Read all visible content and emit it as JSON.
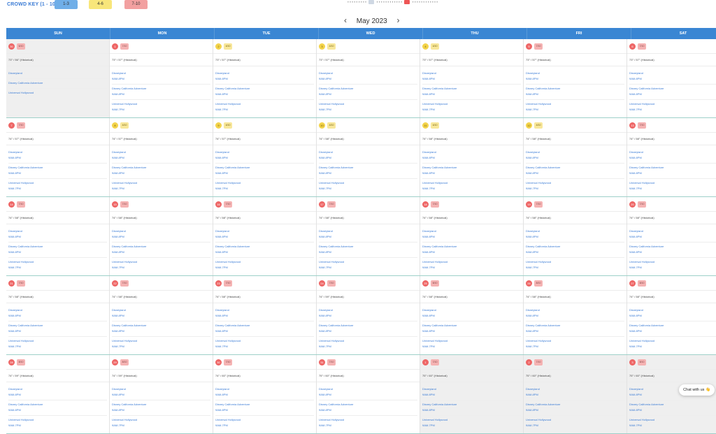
{
  "crowd_key": {
    "label": "CROWD KEY (1 - 10):",
    "levels": [
      {
        "range": "1-3",
        "color": "#6faee8"
      },
      {
        "range": "4-6",
        "color": "#f8e67a"
      },
      {
        "range": "7-10",
        "color": "#f2a0a0"
      }
    ]
  },
  "legend": {
    "text_a": "• • • • • • • • •",
    "text_b": "• • • • • • • • • • • •",
    "text_c": "• • • • • • • • • • • •"
  },
  "month_nav": {
    "title": "May 2023",
    "prev": "‹",
    "next": "›"
  },
  "weekdays": [
    "SUN",
    "MON",
    "TUE",
    "WED",
    "THU",
    "FRI",
    "SAT"
  ],
  "weeks": [
    {
      "days": [
        {
          "num": "30",
          "badge": "6/10",
          "color": "red",
          "weather": "73° / 56° (Historical)",
          "other": true,
          "parks": [
            {
              "name": "Disneyland",
              "hours": ""
            },
            {
              "name": "Disney California Adventure",
              "hours": ""
            },
            {
              "name": "Universal Hollywood",
              "hours": ""
            }
          ]
        },
        {
          "num": "1",
          "badge": "7/10",
          "color": "red",
          "weather": "73° / 57° (Historical)",
          "parks": [
            {
              "name": "Disneyland",
              "hours": "9AM-8PM"
            },
            {
              "name": "Disney California Adventure",
              "hours": "9AM-8PM"
            },
            {
              "name": "Universal Hollywood",
              "hours": "9AM-7PM"
            }
          ]
        },
        {
          "num": "2",
          "badge": "4/10",
          "color": "yellow",
          "weather": "73° / 57° (Historical)",
          "parks": [
            {
              "name": "Disneyland",
              "hours": "9AM-8PM"
            },
            {
              "name": "Disney California Adventure",
              "hours": "9AM-8PM"
            },
            {
              "name": "Universal Hollywood",
              "hours": "9AM-7PM"
            }
          ]
        },
        {
          "num": "3",
          "badge": "4/10",
          "color": "yellow",
          "weather": "73° / 57° (Historical)",
          "parks": [
            {
              "name": "Disneyland",
              "hours": "9AM-8PM"
            },
            {
              "name": "Disney California Adventure",
              "hours": "9AM-8PM"
            },
            {
              "name": "Universal Hollywood",
              "hours": "9AM-7PM"
            }
          ]
        },
        {
          "num": "4",
          "badge": "4/10",
          "color": "yellow",
          "weather": "73° / 57° (Historical)",
          "parks": [
            {
              "name": "Disneyland",
              "hours": "9AM-8PM"
            },
            {
              "name": "Disney California Adventure",
              "hours": "9AM-8PM"
            },
            {
              "name": "Universal Hollywood",
              "hours": "9AM-7PM"
            }
          ]
        },
        {
          "num": "5",
          "badge": "7/10",
          "color": "red",
          "weather": "73° / 57° (Historical)",
          "parks": [
            {
              "name": "Disneyland",
              "hours": "9AM-8PM"
            },
            {
              "name": "Disney California Adventure",
              "hours": "9AM-8PM"
            },
            {
              "name": "Universal Hollywood",
              "hours": "9AM-7PM"
            }
          ]
        },
        {
          "num": "6",
          "badge": "7/10",
          "color": "red",
          "weather": "73° / 57° (Historical)",
          "parks": [
            {
              "name": "Disneyland",
              "hours": "9AM-8PM"
            },
            {
              "name": "Disney California Adventure",
              "hours": "9AM-8PM"
            },
            {
              "name": "Universal Hollywood",
              "hours": "9AM-7PM"
            }
          ]
        }
      ]
    },
    {
      "days": [
        {
          "num": "7",
          "badge": "7/10",
          "color": "red",
          "weather": "74° / 57° (Historical)",
          "parks": [
            {
              "name": "Disneyland",
              "hours": "9AM-8PM"
            },
            {
              "name": "Disney California Adventure",
              "hours": "9AM-8PM"
            },
            {
              "name": "Universal Hollywood",
              "hours": "9AM-7PM"
            }
          ]
        },
        {
          "num": "8",
          "badge": "4/10",
          "color": "yellow",
          "weather": "74° / 57° (Historical)",
          "parks": [
            {
              "name": "Disneyland",
              "hours": "9AM-8PM"
            },
            {
              "name": "Disney California Adventure",
              "hours": "9AM-8PM"
            },
            {
              "name": "Universal Hollywood",
              "hours": "9AM-7PM"
            }
          ]
        },
        {
          "num": "9",
          "badge": "4/10",
          "color": "yellow",
          "weather": "74° / 57° (Historical)",
          "parks": [
            {
              "name": "Disneyland",
              "hours": "9AM-8PM"
            },
            {
              "name": "Disney California Adventure",
              "hours": "9AM-8PM"
            },
            {
              "name": "Universal Hollywood",
              "hours": "9AM-7PM"
            }
          ]
        },
        {
          "num": "10",
          "badge": "4/10",
          "color": "yellow",
          "weather": "74° / 58° (Historical)",
          "parks": [
            {
              "name": "Disneyland",
              "hours": "9AM-8PM"
            },
            {
              "name": "Disney California Adventure",
              "hours": "9AM-8PM"
            },
            {
              "name": "Universal Hollywood",
              "hours": "9AM-7PM"
            }
          ]
        },
        {
          "num": "11",
          "badge": "4/10",
          "color": "yellow",
          "weather": "74° / 58° (Historical)",
          "parks": [
            {
              "name": "Disneyland",
              "hours": "9AM-8PM"
            },
            {
              "name": "Disney California Adventure",
              "hours": "9AM-8PM"
            },
            {
              "name": "Universal Hollywood",
              "hours": "9AM-7PM"
            }
          ]
        },
        {
          "num": "12",
          "badge": "4/10",
          "color": "yellow",
          "weather": "74° / 58° (Historical)",
          "parks": [
            {
              "name": "Disneyland",
              "hours": "9AM-8PM"
            },
            {
              "name": "Disney California Adventure",
              "hours": "9AM-8PM"
            },
            {
              "name": "Universal Hollywood",
              "hours": "9AM-7PM"
            }
          ]
        },
        {
          "num": "13",
          "badge": "7/10",
          "color": "red",
          "weather": "74° / 58° (Historical)",
          "parks": [
            {
              "name": "Disneyland",
              "hours": "9AM-8PM"
            },
            {
              "name": "Disney California Adventure",
              "hours": "9AM-8PM"
            },
            {
              "name": "Universal Hollywood",
              "hours": "9AM-7PM"
            }
          ]
        }
      ]
    },
    {
      "days": [
        {
          "num": "14",
          "badge": "7/10",
          "color": "red",
          "weather": "74° / 58° (Historical)",
          "parks": [
            {
              "name": "Disneyland",
              "hours": "9AM-8PM"
            },
            {
              "name": "Disney California Adventure",
              "hours": "9AM-8PM"
            },
            {
              "name": "Universal Hollywood",
              "hours": "9AM-7PM"
            }
          ]
        },
        {
          "num": "15",
          "badge": "7/10",
          "color": "red",
          "weather": "74° / 58° (Historical)",
          "parks": [
            {
              "name": "Disneyland",
              "hours": "9AM-8PM"
            },
            {
              "name": "Disney California Adventure",
              "hours": "9AM-8PM"
            },
            {
              "name": "Universal Hollywood",
              "hours": "9AM-7PM"
            }
          ]
        },
        {
          "num": "16",
          "badge": "7/10",
          "color": "red",
          "weather": "74° / 58° (Historical)",
          "parks": [
            {
              "name": "Disneyland",
              "hours": "9AM-8PM"
            },
            {
              "name": "Disney California Adventure",
              "hours": "9AM-8PM"
            },
            {
              "name": "Universal Hollywood",
              "hours": "9AM-7PM"
            }
          ]
        },
        {
          "num": "17",
          "badge": "7/10",
          "color": "red",
          "weather": "74° / 58° (Historical)",
          "parks": [
            {
              "name": "Disneyland",
              "hours": "9AM-8PM"
            },
            {
              "name": "Disney California Adventure",
              "hours": "9AM-8PM"
            },
            {
              "name": "Universal Hollywood",
              "hours": "9AM-7PM"
            }
          ]
        },
        {
          "num": "18",
          "badge": "7/10",
          "color": "red",
          "weather": "74° / 58° (Historical)",
          "parks": [
            {
              "name": "Disneyland",
              "hours": "9AM-8PM"
            },
            {
              "name": "Disney California Adventure",
              "hours": "9AM-8PM"
            },
            {
              "name": "Universal Hollywood",
              "hours": "9AM-7PM"
            }
          ]
        },
        {
          "num": "19",
          "badge": "7/10",
          "color": "red",
          "weather": "74° / 58° (Historical)",
          "parks": [
            {
              "name": "Disneyland",
              "hours": "9AM-8PM"
            },
            {
              "name": "Disney California Adventure",
              "hours": "9AM-8PM"
            },
            {
              "name": "Universal Hollywood",
              "hours": "9AM-7PM"
            }
          ]
        },
        {
          "num": "20",
          "badge": "7/10",
          "color": "red",
          "weather": "74° / 58° (Historical)",
          "parks": [
            {
              "name": "Disneyland",
              "hours": "9AM-8PM"
            },
            {
              "name": "Disney California Adventure",
              "hours": "9AM-8PM"
            },
            {
              "name": "Universal Hollywood",
              "hours": "9AM-7PM"
            }
          ]
        }
      ]
    },
    {
      "days": [
        {
          "num": "21",
          "badge": "7/10",
          "color": "red",
          "weather": "74° / 58° (Historical)",
          "parks": [
            {
              "name": "Disneyland",
              "hours": "9AM-8PM"
            },
            {
              "name": "Disney California Adventure",
              "hours": "9AM-8PM"
            },
            {
              "name": "Universal Hollywood",
              "hours": "9AM-7PM"
            }
          ]
        },
        {
          "num": "22",
          "badge": "7/10",
          "color": "red",
          "weather": "74° / 58° (Historical)",
          "parks": [
            {
              "name": "Disneyland",
              "hours": "9AM-8PM"
            },
            {
              "name": "Disney California Adventure",
              "hours": "9AM-8PM"
            },
            {
              "name": "Universal Hollywood",
              "hours": "9AM-7PM"
            }
          ]
        },
        {
          "num": "23",
          "badge": "7/10",
          "color": "red",
          "weather": "74° / 58° (Historical)",
          "parks": [
            {
              "name": "Disneyland",
              "hours": "9AM-8PM"
            },
            {
              "name": "Disney California Adventure",
              "hours": "9AM-8PM"
            },
            {
              "name": "Universal Hollywood",
              "hours": "9AM-7PM"
            }
          ]
        },
        {
          "num": "24",
          "badge": "7/10",
          "color": "red",
          "weather": "74° / 59° (Historical)",
          "parks": [
            {
              "name": "Disneyland",
              "hours": "9AM-8PM"
            },
            {
              "name": "Disney California Adventure",
              "hours": "9AM-8PM"
            },
            {
              "name": "Universal Hollywood",
              "hours": "9AM-7PM"
            }
          ]
        },
        {
          "num": "25",
          "badge": "8/10",
          "color": "red",
          "weather": "74° / 58° (Historical)",
          "parks": [
            {
              "name": "Disneyland",
              "hours": "9AM-8PM"
            },
            {
              "name": "Disney California Adventure",
              "hours": "9AM-8PM"
            },
            {
              "name": "Universal Hollywood",
              "hours": "9AM-7PM"
            }
          ]
        },
        {
          "num": "26",
          "badge": "8/10",
          "color": "red",
          "weather": "74° / 58° (Historical)",
          "parks": [
            {
              "name": "Disneyland",
              "hours": "9AM-8PM"
            },
            {
              "name": "Disney California Adventure",
              "hours": "9AM-8PM"
            },
            {
              "name": "Universal Hollywood",
              "hours": "9AM-7PM"
            }
          ]
        },
        {
          "num": "27",
          "badge": "8/10",
          "color": "red",
          "weather": "74° / 58° (Historical)",
          "parks": [
            {
              "name": "Disneyland",
              "hours": "9AM-8PM"
            },
            {
              "name": "Disney California Adventure",
              "hours": "9AM-8PM"
            },
            {
              "name": "Universal Hollywood",
              "hours": "9AM-7PM"
            }
          ]
        }
      ]
    },
    {
      "days": [
        {
          "num": "28",
          "badge": "8/10",
          "color": "red",
          "weather": "74° / 59° (Historical)",
          "parks": [
            {
              "name": "Disneyland",
              "hours": "9AM-8PM"
            },
            {
              "name": "Disney California Adventure",
              "hours": "9AM-8PM"
            },
            {
              "name": "Universal Hollywood",
              "hours": "9AM-7PM"
            }
          ]
        },
        {
          "num": "29",
          "badge": "8/10",
          "color": "red",
          "weather": "74° / 59° (Historical)",
          "parks": [
            {
              "name": "Disneyland",
              "hours": "9AM-8PM"
            },
            {
              "name": "Disney California Adventure",
              "hours": "9AM-8PM"
            },
            {
              "name": "Universal Hollywood",
              "hours": "9AM-7PM"
            }
          ]
        },
        {
          "num": "30",
          "badge": "7/10",
          "color": "red",
          "weather": "74° / 60° (Historical)",
          "parks": [
            {
              "name": "Disneyland",
              "hours": "9AM-8PM"
            },
            {
              "name": "Disney California Adventure",
              "hours": "9AM-8PM"
            },
            {
              "name": "Universal Hollywood",
              "hours": "9AM-7PM"
            }
          ]
        },
        {
          "num": "31",
          "badge": "7/10",
          "color": "red",
          "weather": "75° / 60° (Historical)",
          "parks": [
            {
              "name": "Disneyland",
              "hours": "9AM-8PM"
            },
            {
              "name": "Disney California Adventure",
              "hours": "9AM-8PM"
            },
            {
              "name": "Universal Hollywood",
              "hours": "9AM-7PM"
            }
          ]
        },
        {
          "num": "1",
          "badge": "7/10",
          "color": "red",
          "weather": "75° / 60° (Historical)",
          "other": true,
          "parks": [
            {
              "name": "Disneyland",
              "hours": "9AM-8PM"
            },
            {
              "name": "Disney California Adventure",
              "hours": "9AM-8PM"
            },
            {
              "name": "Universal Hollywood",
              "hours": "9AM-7PM"
            }
          ]
        },
        {
          "num": "2",
          "badge": "7/10",
          "color": "red",
          "weather": "75° / 60° (Historical)",
          "other": true,
          "parks": [
            {
              "name": "Disneyland",
              "hours": "9AM-8PM"
            },
            {
              "name": "Disney California Adventure",
              "hours": "9AM-8PM"
            },
            {
              "name": "Universal Hollywood",
              "hours": "9AM-7PM"
            }
          ]
        },
        {
          "num": "3",
          "badge": "8/10",
          "color": "red",
          "weather": "75° / 60° (Historical)",
          "other": true,
          "parks": [
            {
              "name": "Disneyland",
              "hours": "9AM-8PM"
            },
            {
              "name": "Disney California Adventure",
              "hours": "9AM-8PM"
            },
            {
              "name": "Universal Hollywood",
              "hours": "9AM-7PM"
            }
          ]
        }
      ]
    }
  ],
  "chat_button": {
    "label": "Chat with us 👋"
  }
}
